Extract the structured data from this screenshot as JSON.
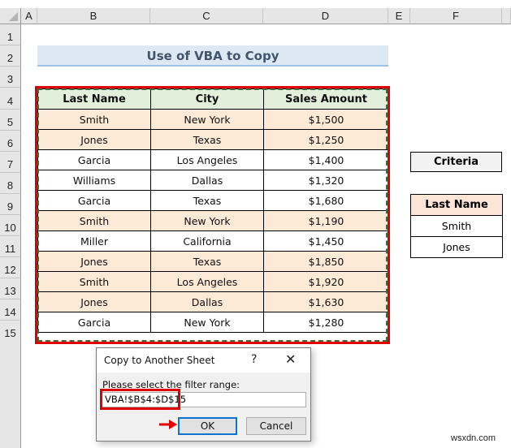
{
  "columns": [
    "A",
    "B",
    "C",
    "D",
    "E",
    "F"
  ],
  "rows": [
    "1",
    "2",
    "3",
    "4",
    "5",
    "6",
    "7",
    "8",
    "9",
    "10",
    "11",
    "12",
    "13",
    "14",
    "15"
  ],
  "title": "Use of VBA to Copy",
  "table": {
    "headers": [
      "Last Name",
      "City",
      "Sales Amount"
    ],
    "rows": [
      [
        "Smith",
        "New York",
        "$1,500"
      ],
      [
        "Jones",
        "Texas",
        "$1,250"
      ],
      [
        "Garcia",
        "Los Angeles",
        "$1,400"
      ],
      [
        "Williams",
        "Dallas",
        "$1,320"
      ],
      [
        "Garcia",
        "Texas",
        "$1,680"
      ],
      [
        "Smith",
        "New York",
        "$1,190"
      ],
      [
        "Miller",
        "California",
        "$1,450"
      ],
      [
        "Jones",
        "Texas",
        "$1,850"
      ],
      [
        "Smith",
        "Los Angeles",
        "$1,920"
      ],
      [
        "Jones",
        "Dallas",
        "$1,630"
      ],
      [
        "Garcia",
        "New York",
        "$1,280"
      ]
    ],
    "row_fill": [
      "peach",
      "peach",
      "white",
      "white",
      "white",
      "peach",
      "white",
      "peach",
      "peach",
      "peach",
      "white"
    ]
  },
  "criteria": {
    "label": "Criteria",
    "header": "Last Name",
    "values": [
      "Smith",
      "Jones"
    ]
  },
  "dialog": {
    "title": "Copy to Another Sheet",
    "help": "?",
    "close": "✕",
    "label": "Please select the filter range:",
    "input_value": "VBA!$B$4:$D$15",
    "ok": "OK",
    "cancel": "Cancel"
  },
  "watermark": "wsxdn.com",
  "colors": {
    "highlight_red": "#e00000",
    "header_green": "#e2efda",
    "row_peach": "#fce9d6",
    "ok_border": "#0a74d1"
  }
}
